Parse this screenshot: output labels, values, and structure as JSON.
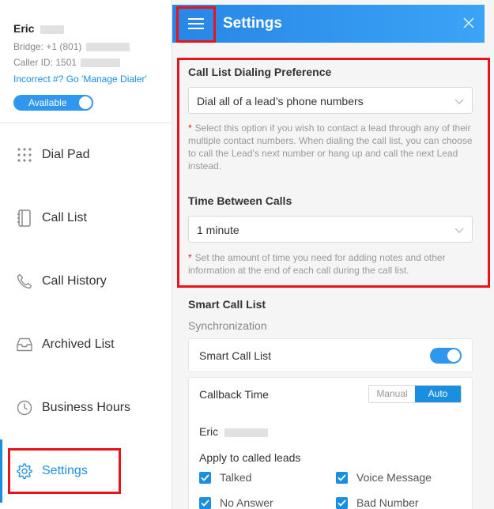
{
  "user": {
    "name": "Eric",
    "bridge": "Bridge: +1 (801)",
    "caller_id": "Caller ID: 1501",
    "incorrect_link": "Incorrect #? Go 'Manage Dialer'",
    "status_label": "Available"
  },
  "sidebar": {
    "items": [
      {
        "label": "Dial Pad",
        "icon": "dialpad-icon"
      },
      {
        "label": "Call List",
        "icon": "call-list-icon"
      },
      {
        "label": "Call History",
        "icon": "phone-icon"
      },
      {
        "label": "Archived List",
        "icon": "inbox-icon"
      },
      {
        "label": "Business Hours",
        "icon": "clock-icon"
      },
      {
        "label": "Settings",
        "icon": "gear-icon"
      }
    ],
    "active": "Settings"
  },
  "panel": {
    "title": "Settings",
    "dialing": {
      "title": "Call List Dialing Preference",
      "value": "Dial all of a lead’s phone numbers",
      "note": "Select this option if you wish to contact a lead through any of their multiple contact numbers. When dialing the call list, you can choose to call the Lead’s next number or hang up and call the next Lead instead."
    },
    "time_between": {
      "title": "Time Between Calls",
      "value": "1 minute",
      "note": "Set the amount of time you need for adding notes and other information at the end of each call during the call list."
    },
    "smart": {
      "title": "Smart Call List",
      "subtitle": "Synchronization",
      "toggle_label": "Smart Call List",
      "toggle_on": true,
      "callback_label": "Callback Time",
      "options": [
        "Manual",
        "Auto"
      ],
      "selected": "Auto",
      "owner": "Eric",
      "apply_label": "Apply to called leads",
      "checks": [
        {
          "label": "Talked",
          "checked": true
        },
        {
          "label": "Voice Message",
          "checked": true
        },
        {
          "label": "No Answer",
          "checked": true
        },
        {
          "label": "Bad Number",
          "checked": true
        }
      ]
    }
  },
  "colors": {
    "accent": "#1a8fe0",
    "header_start": "#2886e6",
    "header_end": "#3aa4f6",
    "highlight": "#e8141c",
    "required_star": "#e8141c"
  }
}
